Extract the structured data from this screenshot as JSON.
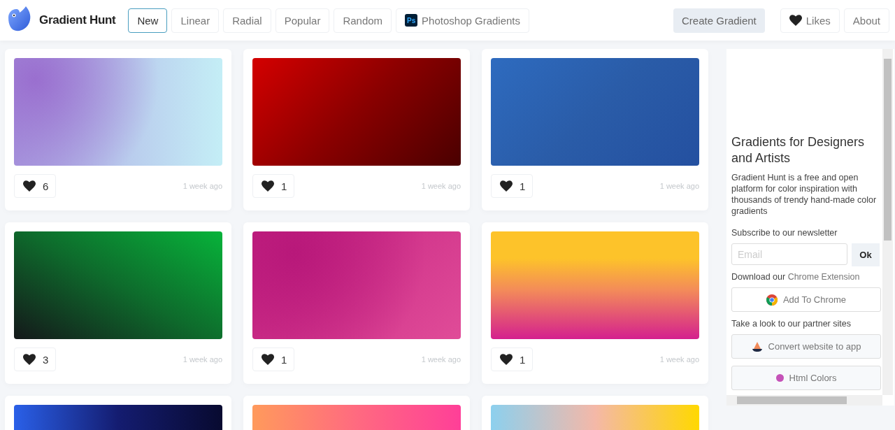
{
  "header": {
    "brand": "Gradient Hunt",
    "tabs": [
      {
        "label": "New",
        "selected": true,
        "kind": "plain"
      },
      {
        "label": "Linear",
        "selected": false,
        "kind": "plain"
      },
      {
        "label": "Radial",
        "selected": false,
        "kind": "plain"
      },
      {
        "label": "Popular",
        "selected": false,
        "kind": "plain"
      },
      {
        "label": "Random",
        "selected": false,
        "kind": "plain"
      },
      {
        "label": "Photoshop Gradients",
        "selected": false,
        "kind": "photoshop",
        "icon_text": "Ps"
      }
    ],
    "create_button": "Create Gradient",
    "likes_button": "Likes",
    "about_button": "About"
  },
  "cards": [
    {
      "kind": "full",
      "likes": "6",
      "time": "1 week ago"
    },
    {
      "kind": "full",
      "likes": "1",
      "time": "1 week ago"
    },
    {
      "kind": "full",
      "likes": "1",
      "time": "1 week ago"
    },
    {
      "kind": "full",
      "likes": "3",
      "time": "1 week ago"
    },
    {
      "kind": "full",
      "likes": "1",
      "time": "1 week ago"
    },
    {
      "kind": "full",
      "likes": "1",
      "time": "1 week ago"
    },
    {
      "kind": "cut_off"
    },
    {
      "kind": "cut_off"
    },
    {
      "kind": "cut_off"
    }
  ],
  "sidebar": {
    "title": "Gradients for Designers and Artists",
    "description": "Gradient Hunt is a free and open platform for color inspiration with thousands of trendy hand-made color gradients",
    "newsletter_label": "Subscribe to our newsletter",
    "email_placeholder": "Email",
    "ok_button": "Ok",
    "download_text": "Download our",
    "extension_link": "Chrome Extension",
    "chrome_button": "Add To Chrome",
    "partners_label": "Take a look to our partner sites",
    "partners": [
      {
        "label": "Convert website to app",
        "kind": "boat"
      },
      {
        "label": "Html Colors",
        "kind": "dot"
      }
    ]
  }
}
